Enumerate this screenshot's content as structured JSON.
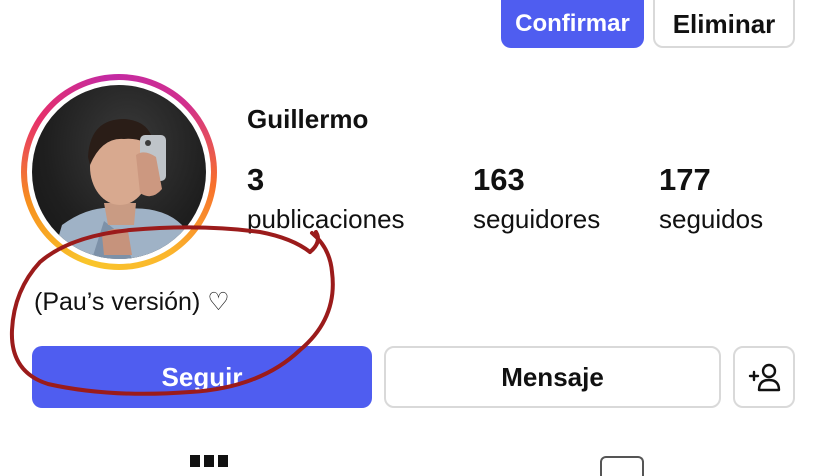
{
  "request": {
    "confirm_label": "Confirmar",
    "delete_label": "Eliminar"
  },
  "profile": {
    "name": "Guillermo",
    "stats": [
      {
        "value": "3",
        "label": "publicaciones"
      },
      {
        "value": "163",
        "label": "seguidores"
      },
      {
        "value": "177",
        "label": "seguidos"
      }
    ],
    "bio": "(Pau’s versión) ♡"
  },
  "actions": {
    "follow_label": "Seguir",
    "message_label": "Mensaje",
    "add_user_icon": "add-person-icon"
  },
  "colors": {
    "primary": "#4f5df0",
    "annotation": "#9b1b1b"
  }
}
